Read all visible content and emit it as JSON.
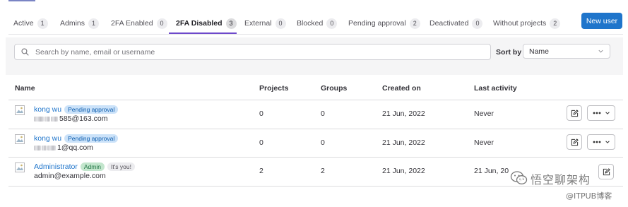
{
  "tabs": [
    {
      "label": "Active",
      "count": "1"
    },
    {
      "label": "Admins",
      "count": "1"
    },
    {
      "label": "2FA Enabled",
      "count": "0"
    },
    {
      "label": "2FA Disabled",
      "count": "3"
    },
    {
      "label": "External",
      "count": "0"
    },
    {
      "label": "Blocked",
      "count": "0"
    },
    {
      "label": "Pending approval",
      "count": "2"
    },
    {
      "label": "Deactivated",
      "count": "0"
    },
    {
      "label": "Without projects",
      "count": "2"
    }
  ],
  "active_tab": "2FA Disabled",
  "new_user_label": "New user",
  "search": {
    "placeholder": "Search by name, email or username"
  },
  "sort": {
    "label": "Sort by",
    "value": "Name"
  },
  "columns": {
    "name": "Name",
    "projects": "Projects",
    "groups": "Groups",
    "created_on": "Created on",
    "last_activity": "Last activity"
  },
  "users": [
    {
      "name": "kong wu",
      "badges": [
        "Pending approval"
      ],
      "email_visible": "585@163.com",
      "projects": "0",
      "groups": "0",
      "created_on": "21 Jun, 2022",
      "last_activity": "Never"
    },
    {
      "name": "kong wu",
      "badges": [
        "Pending approval"
      ],
      "email_visible": "1@qq.com",
      "projects": "0",
      "groups": "0",
      "created_on": "21 Jun, 2022",
      "last_activity": "Never"
    },
    {
      "name": "Administrator",
      "badges": [
        "Admin",
        "It's you!"
      ],
      "email_visible": "admin@example.com",
      "projects": "2",
      "groups": "2",
      "created_on": "21 Jun, 2022",
      "last_activity": "21 Jun, 20"
    }
  ],
  "watermark": {
    "line1": "悟空聊架构",
    "line2": "@ITPUB博客"
  },
  "colors": {
    "accent": "#1f75cb",
    "tab_underline": "#6e49cb",
    "info_badge": "#cbe2f9",
    "success_badge": "#c3e6cd"
  }
}
